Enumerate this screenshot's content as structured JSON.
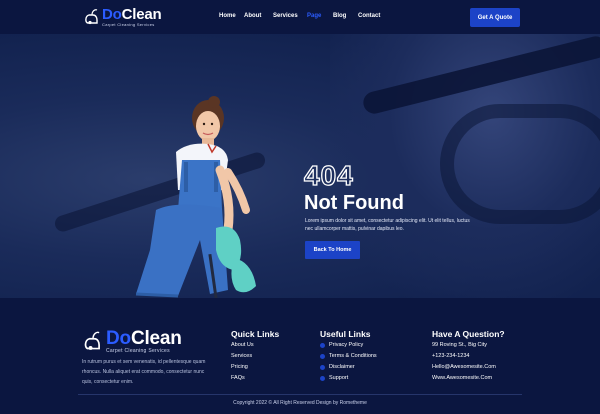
{
  "header": {
    "logo": {
      "do": "Do",
      "clean": "Clean",
      "tagline": "Carpet Cleaning Services"
    },
    "nav": [
      {
        "label": "Home",
        "active": false
      },
      {
        "label": "About",
        "active": false
      },
      {
        "label": "Services",
        "active": false
      },
      {
        "label": "Page",
        "active": true
      },
      {
        "label": "Blog",
        "active": false
      },
      {
        "label": "Contact",
        "active": false
      }
    ],
    "cta_label": "Get A Quote"
  },
  "hero": {
    "code": "404",
    "title": "Not Found",
    "description": "Lorem ipsum dolor sit amet, consectetur adipiscing elit. Ut elit tellus, luctus nec ullamcorper mattis, pulvinar dapibus leo.",
    "button_label": "Back To Home"
  },
  "footer": {
    "logo": {
      "do": "Do",
      "clean": "Clean",
      "tagline": "Carpet Cleaning Services"
    },
    "description": "In rutrum purus et sem venenatis, id pellentesque quam rhoncus. Nulla aliquet erat commodo, consectetur nunc quis, consectetur enim.",
    "quick_links": {
      "title": "Quick Links",
      "items": [
        "About Us",
        "Services",
        "Pricing",
        "FAQs"
      ]
    },
    "useful_links": {
      "title": "Useful Links",
      "items": [
        "Privacy Policy",
        "Terms & Conditions",
        "Disclaimer",
        "Support"
      ]
    },
    "contact": {
      "title": "Have A Question?",
      "items": [
        "99 Roving St., Big City",
        "+123-234-1234",
        "Hello@Awesomesite.Com",
        "Www.Awesomesite.Com"
      ]
    },
    "copyright": "Copyright 2022 © All Right Reserved Design by Rometheme"
  },
  "colors": {
    "accent": "#1c43c7",
    "navy": "#0b1640",
    "hero_bg": "#12224f",
    "active_nav": "#2b5cff"
  }
}
